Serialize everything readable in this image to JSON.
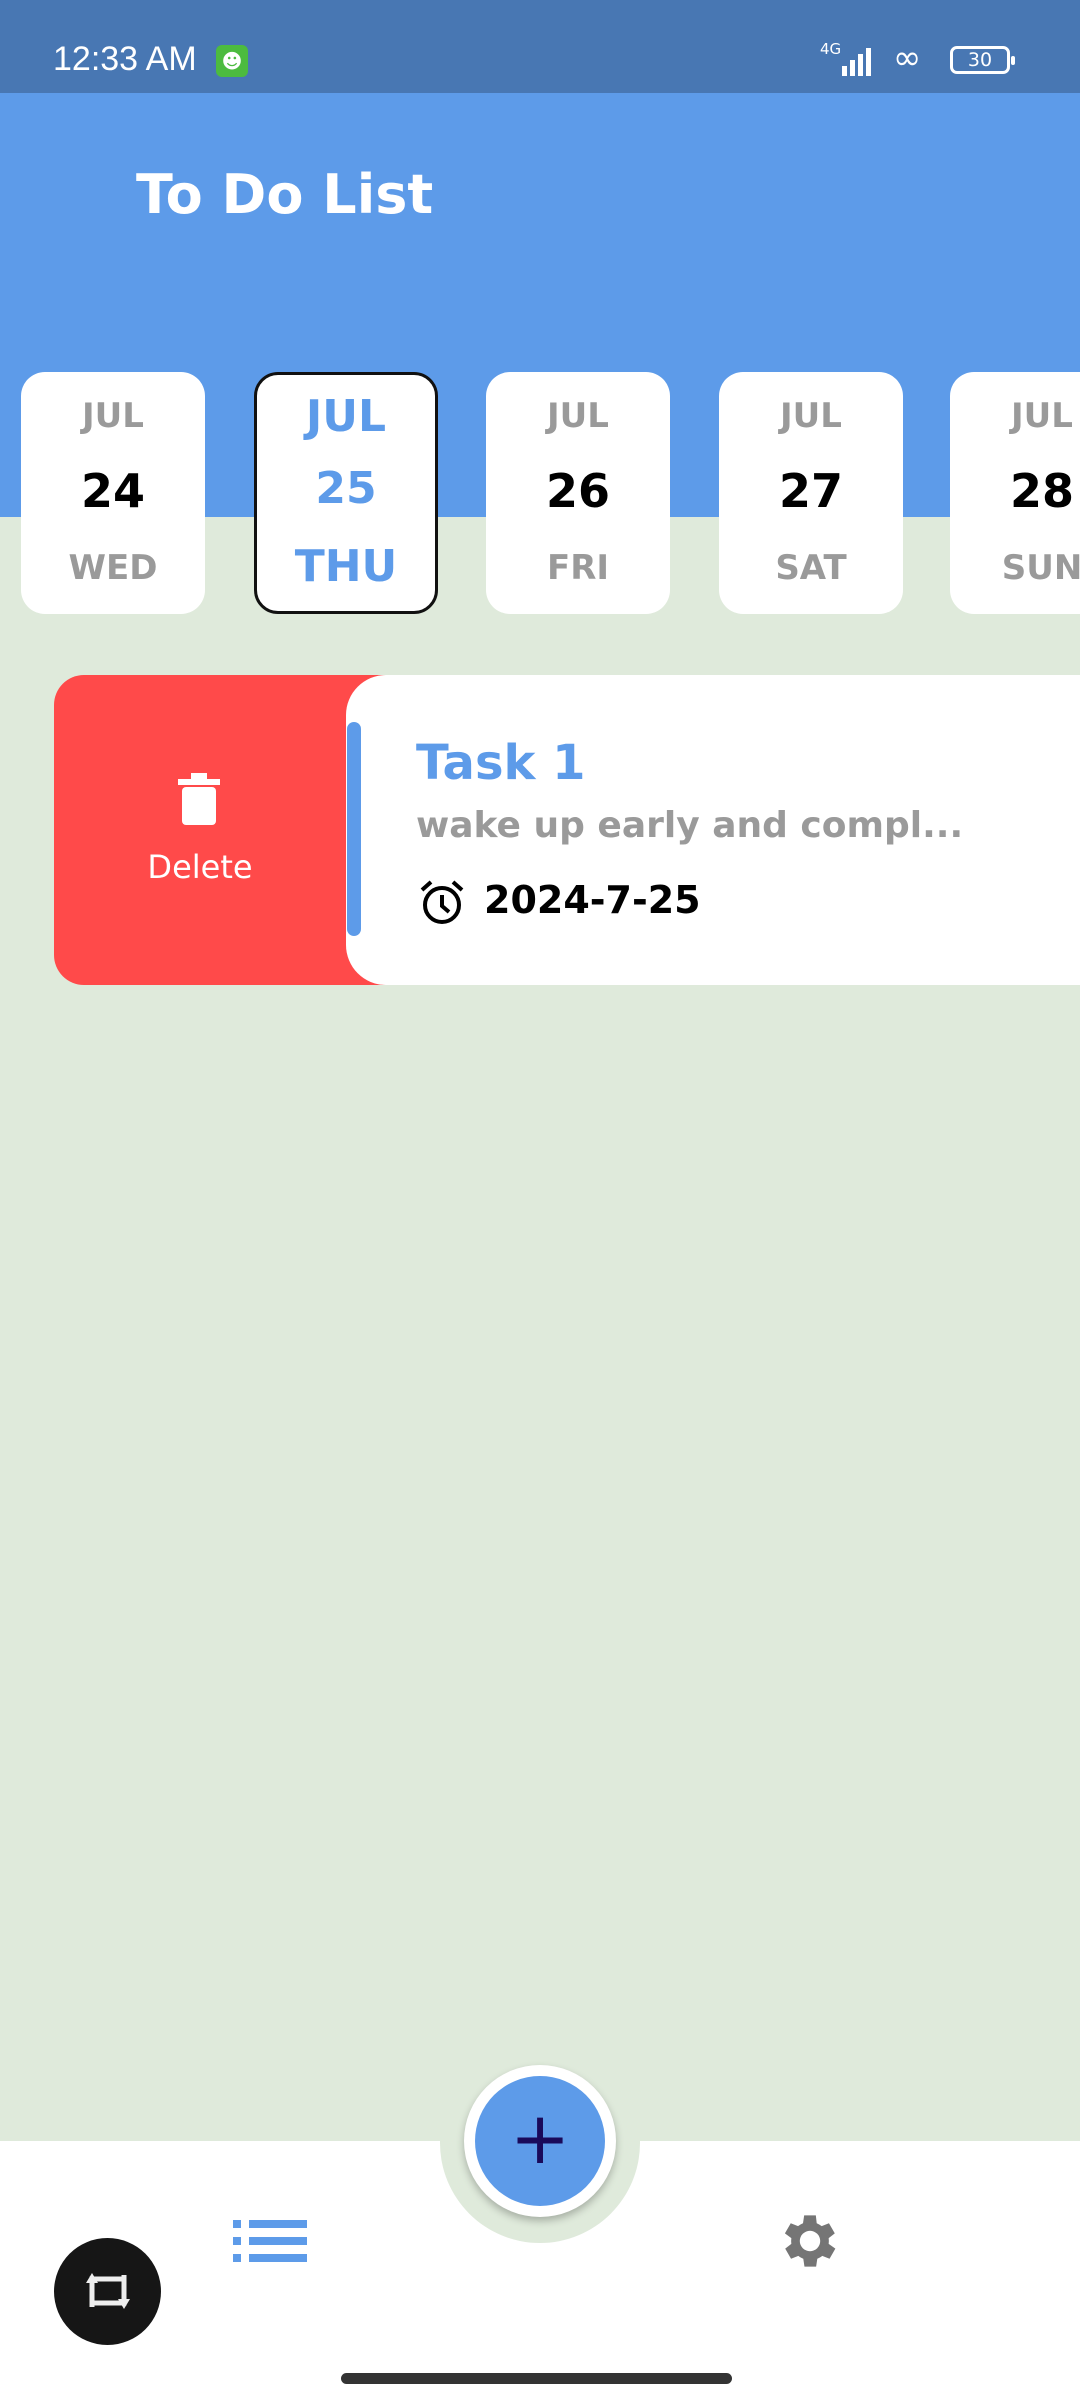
{
  "status_bar": {
    "time": "12:33 AM",
    "network": "4G",
    "battery": "30"
  },
  "header": {
    "title": "To Do List"
  },
  "dates": [
    {
      "month": "JUL",
      "day": "24",
      "weekday": "WED",
      "selected": false
    },
    {
      "month": "JUL",
      "day": "25",
      "weekday": "THU",
      "selected": true
    },
    {
      "month": "JUL",
      "day": "26",
      "weekday": "FRI",
      "selected": false
    },
    {
      "month": "JUL",
      "day": "27",
      "weekday": "SAT",
      "selected": false
    },
    {
      "month": "JUL",
      "day": "28",
      "weekday": "SUN",
      "selected": false
    }
  ],
  "task": {
    "title": "Task 1",
    "description": "wake up early and compl...",
    "date": "2024-7-25",
    "delete_label": "Delete"
  },
  "fab": {
    "label": "+"
  },
  "colors": {
    "primary": "#5d9be9",
    "background": "#dfeadb",
    "delete": "#ff4a4a",
    "status_bar": "#4877b3"
  }
}
